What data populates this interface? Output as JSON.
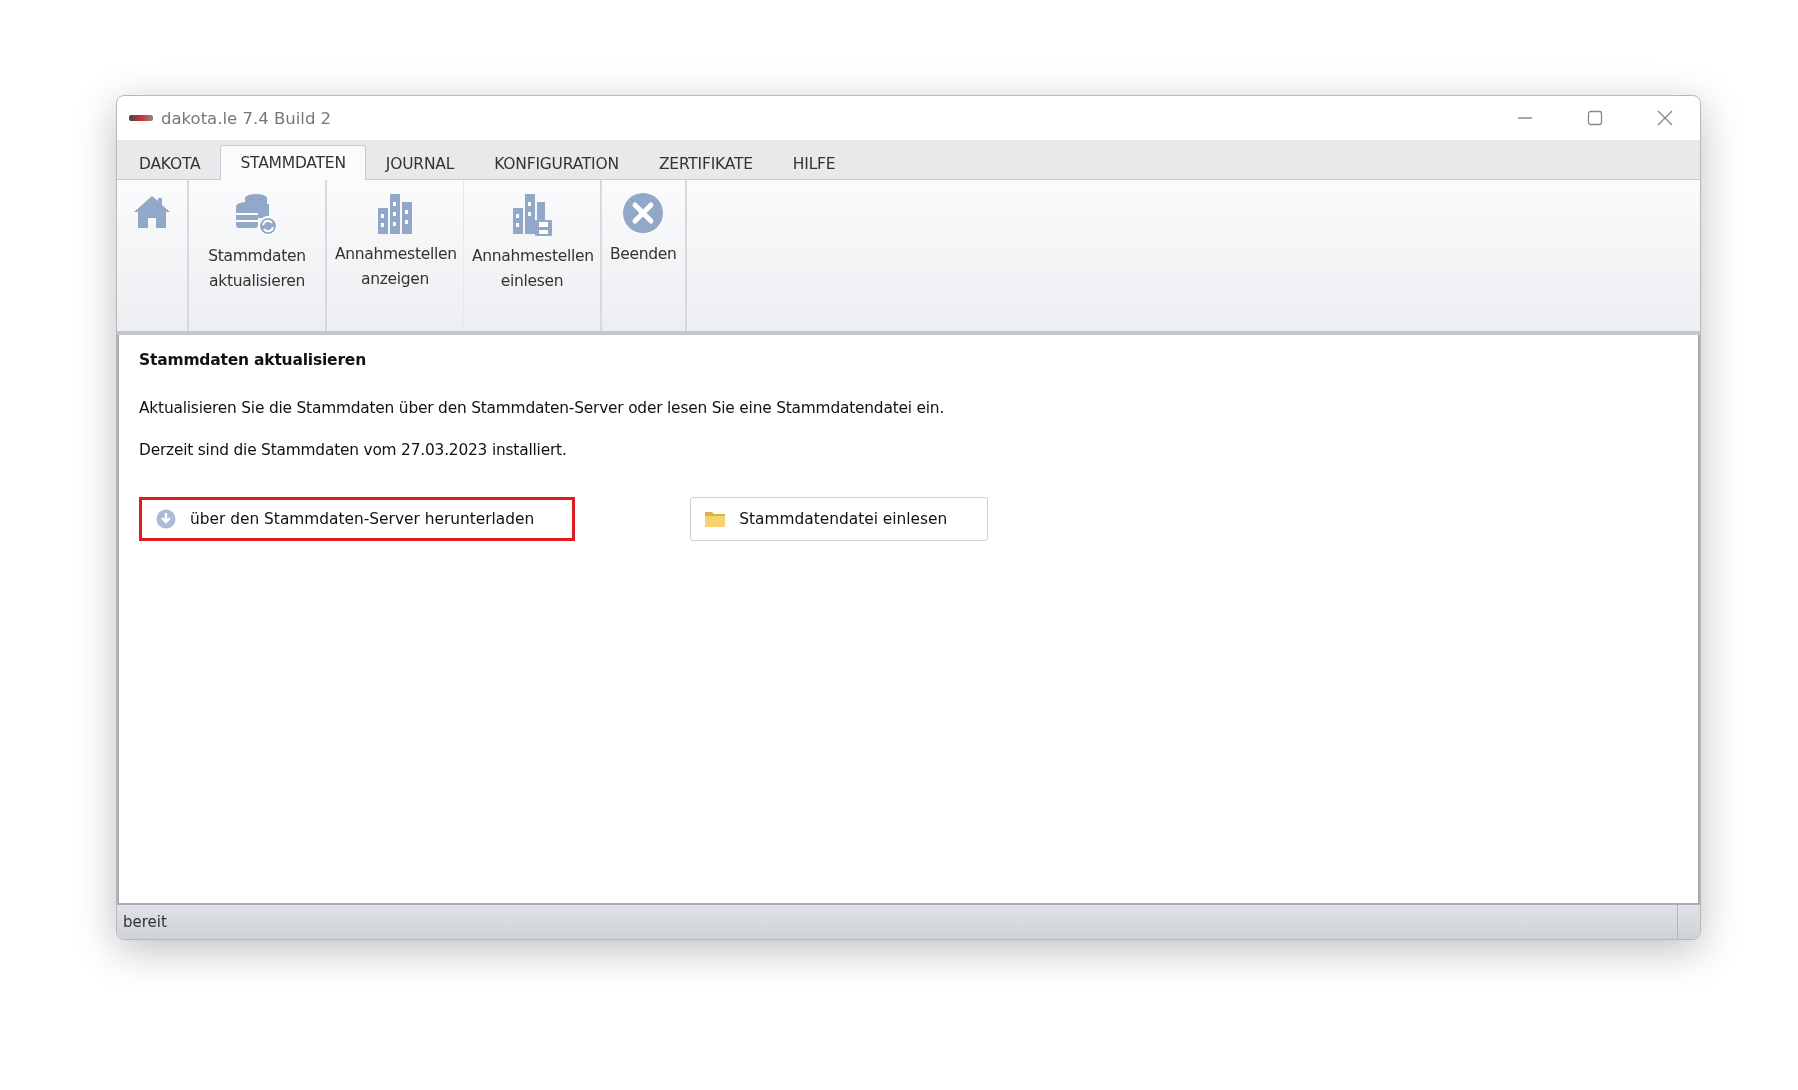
{
  "window": {
    "title": "dakota.le 7.4 Build 2"
  },
  "tabs": [
    {
      "label": "DAKOTA",
      "selected": false
    },
    {
      "label": "STAMMDATEN",
      "selected": true
    },
    {
      "label": "JOURNAL",
      "selected": false
    },
    {
      "label": "KONFIGURATION",
      "selected": false
    },
    {
      "label": "ZERTIFIKATE",
      "selected": false
    },
    {
      "label": "HILFE",
      "selected": false
    }
  ],
  "ribbon": [
    {
      "kind": "home"
    },
    {
      "kind": "database-sync",
      "label": "Stammdaten aktualisieren",
      "group_start": true
    },
    {
      "kind": "building",
      "label": "Annahmestellen anzeigen",
      "group_start": true
    },
    {
      "kind": "building-save",
      "label": "Annahmestellen einlesen",
      "group_start": false
    },
    {
      "kind": "close",
      "label": "Beenden",
      "group_start": true
    }
  ],
  "content": {
    "heading": "Stammdaten aktualisieren",
    "paragraphs": [
      "Aktualisieren Sie die Stammdaten über den Stammdaten-Server oder lesen Sie eine Stammdatendatei ein.",
      "Derzeit sind die Stammdaten vom 27.03.2023 installiert."
    ],
    "buttons": [
      {
        "kind": "download",
        "label": "über den Stammdaten-Server herunterladen",
        "highlighted": true
      },
      {
        "kind": "folder",
        "label": "Stammdatendatei einlesen",
        "highlighted": false
      }
    ]
  },
  "status_bar": {
    "text": "bereit"
  }
}
